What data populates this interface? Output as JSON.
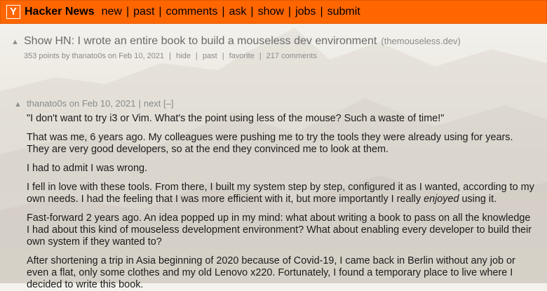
{
  "header": {
    "logo": "Y",
    "brand": "Hacker News",
    "nav": [
      "new",
      "past",
      "comments",
      "ask",
      "show",
      "jobs",
      "submit"
    ],
    "accent": "#ff6600"
  },
  "story": {
    "vote_icon": "upvote-arrow-icon",
    "title": "Show HN: I wrote an entire book to build a mouseless dev environment",
    "site": "(themouseless.dev)",
    "points": "353 points",
    "by": "by",
    "author": "thanato0s",
    "on": "on",
    "date": "Feb 10, 2021",
    "hide": "hide",
    "past": "past",
    "favorite": "favorite",
    "comments": "217 comments"
  },
  "comment": {
    "vote_icon": "upvote-arrow-icon",
    "author": "thanato0s",
    "on": "on",
    "date": "Feb 10, 2021",
    "next": "next",
    "collapse": "[–]",
    "paragraphs": {
      "p1": "\"I don't want to try i3 or Vim. What's the point using less of the mouse? Such a waste of time!\"",
      "p2": "That was me, 6 years ago. My colleagues were pushing me to try the tools they were already using for years. They are very good developers, so at the end they convinced me to look at them.",
      "p3": "I had to admit I was wrong.",
      "p4_before": "I fell in love with these tools. From there, I built my system step by step, configured it as I wanted, according to my own needs. I had the feeling that I was more efficient with it, but more importantly I really ",
      "p4_em": "enjoyed",
      "p4_after": " using it.",
      "p5": "Fast-forward 2 years ago. An idea popped up in my mind: what about writing a book to pass on all the knowledge I had about this kind of mouseless development environment? What about enabling every developer to build their own system if they wanted to?",
      "p6": "After shortening a trip in Asia beginning of 2020 because of Covid-19, I came back in Berlin without any job or even a flat, only some clothes and my old Lenovo x220. Fortunately, I found a temporary place to live where I decided to write this book."
    }
  }
}
